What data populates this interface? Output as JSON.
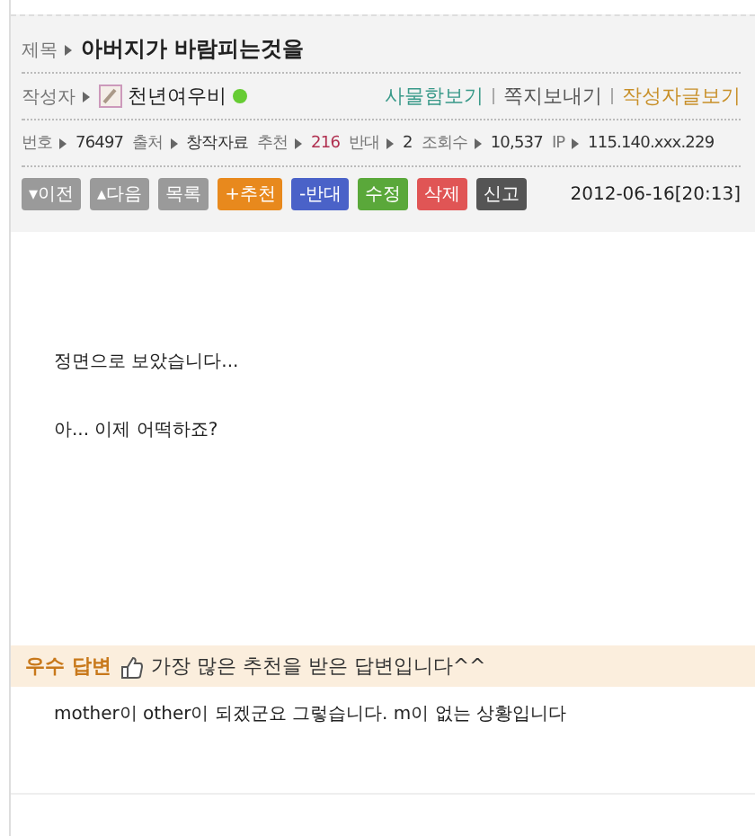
{
  "post": {
    "title_label": "제목",
    "title": "아버지가 바람피는것을",
    "author_label": "작성자",
    "author": "천년여우비",
    "online": true,
    "author_links": [
      {
        "label": "사물함보기",
        "color": "#3a9a8a"
      },
      {
        "label": "쪽지보내기",
        "color": "#555555"
      },
      {
        "label": "작성자글보기",
        "color": "#c8902a"
      }
    ],
    "meta": [
      {
        "label": "번호",
        "value": "76497",
        "color": "#333333"
      },
      {
        "label": "출처",
        "value": "창작자료",
        "color": "#333333"
      },
      {
        "label": "추천",
        "value": "216",
        "color": "#b03050"
      },
      {
        "label": "반대",
        "value": "2",
        "color": "#333333"
      },
      {
        "label": "조회수",
        "value": "10,537",
        "color": "#333333"
      },
      {
        "label": "IP",
        "value": "115.140.xxx.229",
        "color": "#333333"
      }
    ],
    "buttons": [
      {
        "label": "▾이전",
        "color": "#9a9a9a"
      },
      {
        "label": "▴다음",
        "color": "#9a9a9a"
      },
      {
        "label": "목록",
        "color": "#9a9a9a"
      },
      {
        "label": "+추천",
        "color": "#e8891d"
      },
      {
        "label": "-반대",
        "color": "#4a62c8"
      },
      {
        "label": "수정",
        "color": "#5aa83a"
      },
      {
        "label": "삭제",
        "color": "#e05555"
      },
      {
        "label": "신고",
        "color": "#555555"
      }
    ],
    "date": "2012-06-16[20:13]"
  },
  "body": [
    "정면으로 보았습니다...",
    "아... 이제 어떡하죠?"
  ],
  "best_answer": {
    "badge": "우수 답변",
    "note": "가장 많은 추천을 받은 답변입니다^^",
    "text": "mother이 other이 되겠군요 그렇습니다. m이 없는 상황입니다"
  }
}
